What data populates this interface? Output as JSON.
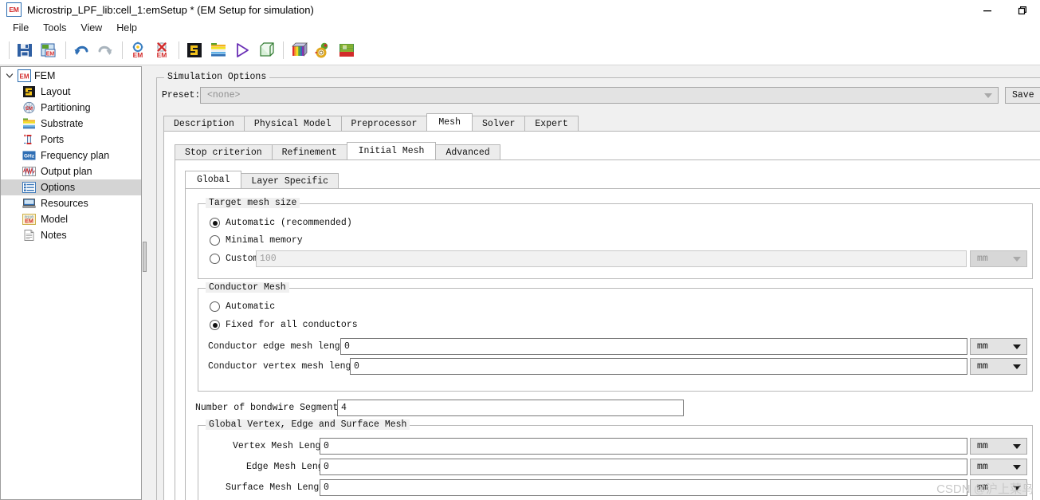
{
  "window": {
    "title": "Microstrip_LPF_lib:cell_1:emSetup * (EM Setup for simulation)",
    "app_badge": "EM",
    "controls": {
      "minimize": "minimize-button",
      "restore": "restore-button"
    }
  },
  "menu": {
    "items": [
      "File",
      "Tools",
      "View",
      "Help"
    ]
  },
  "toolbar": {
    "items": [
      {
        "name": "save-icon",
        "tip": "Save"
      },
      {
        "name": "save-em-setup-icon",
        "tip": "Save EM Setup"
      },
      {
        "name": "undo-icon",
        "tip": "Undo"
      },
      {
        "name": "redo-icon",
        "tip": "Redo"
      },
      {
        "name": "simulate-em-icon",
        "tip": "Simulate EM"
      },
      {
        "name": "stop-em-icon",
        "tip": "Stop EM Simulation"
      },
      {
        "name": "layout-icon",
        "tip": "Layout"
      },
      {
        "name": "substrate-icon",
        "tip": "Substrate"
      },
      {
        "name": "run-icon",
        "tip": "Run"
      },
      {
        "name": "mesh-cube-icon",
        "tip": "3D Mesh View"
      },
      {
        "name": "rainbow-cube-icon",
        "tip": "3D EM View"
      },
      {
        "name": "preferences-icon",
        "tip": "Preferences"
      },
      {
        "name": "em-model-icon",
        "tip": "EM Model"
      }
    ]
  },
  "sidebar": {
    "root": {
      "label": "FEM",
      "badge": "EM",
      "expanded": true
    },
    "items": [
      {
        "label": "Layout",
        "icon": "layout-icon",
        "selected": false
      },
      {
        "label": "Partitioning",
        "icon": "partitioning-icon",
        "selected": false
      },
      {
        "label": "Substrate",
        "icon": "substrate-icon",
        "selected": false
      },
      {
        "label": "Ports",
        "icon": "ports-icon",
        "selected": false
      },
      {
        "label": "Frequency plan",
        "icon": "frequency-plan-icon",
        "selected": false
      },
      {
        "label": "Output plan",
        "icon": "output-plan-icon",
        "selected": false
      },
      {
        "label": "Options",
        "icon": "options-icon",
        "selected": true
      },
      {
        "label": "Resources",
        "icon": "resources-icon",
        "selected": false
      },
      {
        "label": "Model",
        "icon": "model-icon",
        "selected": false
      },
      {
        "label": "Notes",
        "icon": "notes-icon",
        "selected": false
      }
    ]
  },
  "main": {
    "group_title": "Simulation Options",
    "preset": {
      "label": "Preset:",
      "value": "<none>",
      "save_button": "Save"
    },
    "tabs": [
      {
        "label": "Description",
        "active": false
      },
      {
        "label": "Physical Model",
        "active": false
      },
      {
        "label": "Preprocessor",
        "active": false
      },
      {
        "label": "Mesh",
        "active": true
      },
      {
        "label": "Solver",
        "active": false
      },
      {
        "label": "Expert",
        "active": false
      }
    ],
    "subtabs": [
      {
        "label": "Stop criterion",
        "active": false
      },
      {
        "label": "Refinement",
        "active": false
      },
      {
        "label": "Initial Mesh",
        "active": true
      },
      {
        "label": "Advanced",
        "active": false
      }
    ],
    "subsubtabs": [
      {
        "label": "Global",
        "active": true
      },
      {
        "label": "Layer Specific",
        "active": false
      }
    ],
    "target_mesh_size": {
      "title": "Target mesh size",
      "options": [
        {
          "label": "Automatic (recommended)",
          "selected": true
        },
        {
          "label": "Minimal memory",
          "selected": false
        },
        {
          "label": "Custom",
          "selected": false
        }
      ],
      "custom_value": "100",
      "custom_unit": "mm",
      "custom_enabled": false
    },
    "conductor_mesh": {
      "title": "Conductor Mesh",
      "options": [
        {
          "label": "Automatic",
          "selected": false
        },
        {
          "label": "Fixed for all conductors",
          "selected": true
        }
      ],
      "fields": [
        {
          "label": "Conductor edge mesh length:",
          "value": "0",
          "unit": "mm"
        },
        {
          "label": "Conductor vertex mesh length:",
          "value": "0",
          "unit": "mm"
        }
      ]
    },
    "bondwire": {
      "label": "Number of bondwire Segments:",
      "value": "4"
    },
    "global_mesh": {
      "title": "Global Vertex, Edge and Surface Mesh",
      "fields": [
        {
          "label": "Vertex Mesh Length:",
          "value": "0",
          "unit": "mm"
        },
        {
          "label": "Edge Mesh Length:",
          "value": "0",
          "unit": "mm"
        },
        {
          "label": "Surface Mesh Length:",
          "value": "0",
          "unit": "mm"
        }
      ]
    }
  },
  "watermark": "CSDN @沪上菜鸟",
  "colors": {
    "accent": "#0078d7",
    "window_bg": "#f0f0f0",
    "panel_bg": "#ffffff",
    "selection": "#d4d4d4"
  }
}
